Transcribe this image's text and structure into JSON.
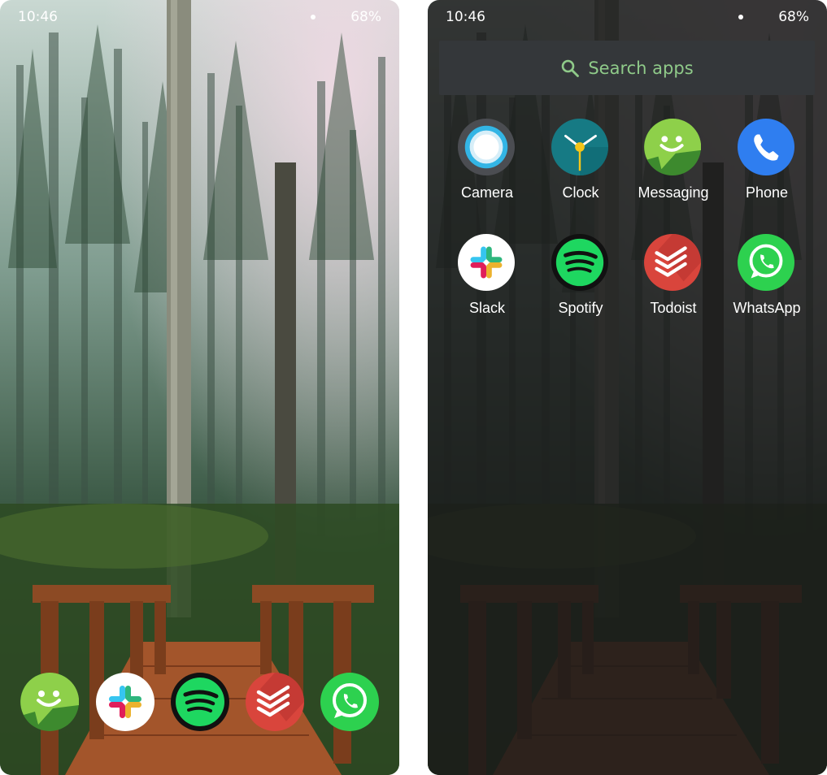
{
  "status_bar": {
    "time": "10:46",
    "battery": "68%"
  },
  "home": {
    "dock": [
      {
        "name": "Messaging",
        "icon": "messaging-icon"
      },
      {
        "name": "Slack",
        "icon": "slack-icon"
      },
      {
        "name": "Spotify",
        "icon": "spotify-icon"
      },
      {
        "name": "Todoist",
        "icon": "todoist-icon"
      },
      {
        "name": "WhatsApp",
        "icon": "whatsapp-icon"
      }
    ]
  },
  "drawer": {
    "search": {
      "placeholder": "Search apps",
      "icon": "search-icon"
    },
    "apps": [
      {
        "label": "Camera",
        "icon": "camera-icon"
      },
      {
        "label": "Clock",
        "icon": "clock-icon"
      },
      {
        "label": "Messaging",
        "icon": "messaging-icon"
      },
      {
        "label": "Phone",
        "icon": "phone-icon"
      },
      {
        "label": "Slack",
        "icon": "slack-icon"
      },
      {
        "label": "Spotify",
        "icon": "spotify-icon"
      },
      {
        "label": "Todoist",
        "icon": "todoist-icon"
      },
      {
        "label": "WhatsApp",
        "icon": "whatsapp-icon"
      }
    ]
  },
  "colors": {
    "search_text": "#8fca89",
    "drawer_overlay": "#1a1a1a",
    "spotify_green": "#1ed760",
    "whatsapp_green": "#2dd14f",
    "todoist_red": "#d9453c",
    "phone_blue": "#2f7ef0",
    "clock_teal": "#167a84",
    "messaging_green": "#8ed04a"
  }
}
